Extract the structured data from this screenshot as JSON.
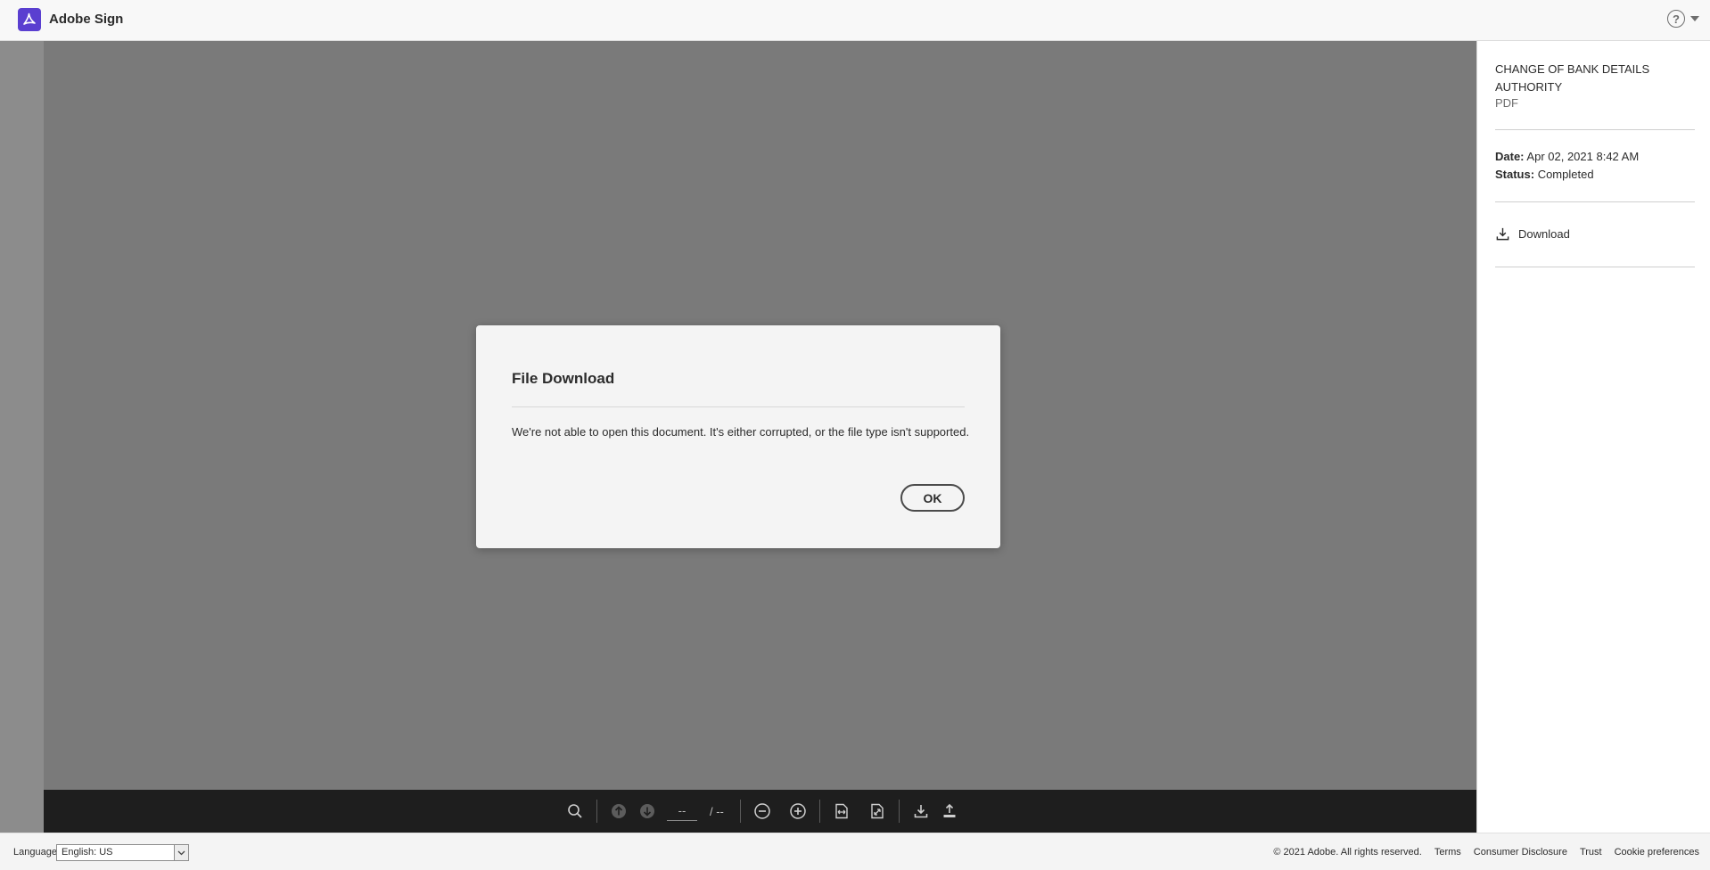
{
  "header": {
    "app_title": "Adobe Sign",
    "help_icon": "help-circle-icon"
  },
  "toolbar": {
    "page_value": "--",
    "page_total": "/ --",
    "icons": [
      "search-icon",
      "previous-page-icon",
      "next-page-icon",
      "zoom-out-icon",
      "zoom-in-icon",
      "fit-width-icon",
      "fit-page-icon",
      "download-icon",
      "upload-icon"
    ]
  },
  "right_panel": {
    "doc_title": "CHANGE OF BANK DETAILS AUTHORITY",
    "doc_type": "PDF",
    "date_label": "Date:",
    "date_value": "Apr 02, 2021 8:42 AM",
    "status_label": "Status:",
    "status_value": "Completed",
    "download_label": "Download"
  },
  "modal": {
    "title": "File Download",
    "message": "We're not able to open this document. It's either corrupted, or the file type isn't supported.",
    "ok_label": "OK"
  },
  "footer": {
    "language_label": "Language",
    "language_selected": "English: US",
    "copyright": "© 2021 Adobe. All rights reserved.",
    "links": [
      "Terms",
      "Consumer Disclosure",
      "Trust",
      "Cookie preferences"
    ]
  },
  "colors": {
    "brand": "#5a3fd0",
    "viewer_bg": "#7a7a7a",
    "toolbar_bg": "#1e1e1e"
  }
}
